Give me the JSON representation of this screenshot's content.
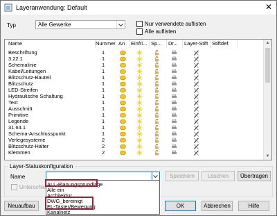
{
  "window": {
    "title": "Layeranwendung: Default",
    "close_glyph": "✕"
  },
  "filter": {
    "type_label": "Typ",
    "type_value": "Alle Gewerke",
    "only_used_label": "Nur verwendete auflisten",
    "all_label": "Alle auflisten"
  },
  "columns": {
    "name": "Name",
    "nummer": "Nummer",
    "an": "An",
    "einfr": "Einfri...",
    "sp": "Sp...",
    "dr": "Dr...",
    "stift": "Layer-Stift",
    "stiftdef": "Stiftdef."
  },
  "rows": [
    {
      "name": "Beschriftung",
      "num": "1",
      "an": "on",
      "fr": "sun",
      "dr": "print"
    },
    {
      "name": "3.22.1",
      "num": "1",
      "an": "on",
      "fr": "sun",
      "dr": "print"
    },
    {
      "name": "Schemalinie",
      "num": "1",
      "an": "on",
      "fr": "sun",
      "dr": "print"
    },
    {
      "name": "Kabel/Leitungen",
      "num": "1",
      "an": "on",
      "fr": "sun",
      "dr": "print"
    },
    {
      "name": "Blitzschutz-Bauteil",
      "num": "1",
      "an": "on",
      "fr": "sun",
      "dr": "print"
    },
    {
      "name": "Blitzschutz",
      "num": "1",
      "an": "on",
      "fr": "sun",
      "dr": "print"
    },
    {
      "name": "LED-Streifen",
      "num": "1",
      "an": "on",
      "fr": "sun",
      "dr": "print"
    },
    {
      "name": "Hydraulische Schaltung",
      "num": "1",
      "an": "on",
      "fr": "sun",
      "dr": "print"
    },
    {
      "name": "Text",
      "num": "1",
      "an": "on",
      "fr": "sun",
      "dr": "print"
    },
    {
      "name": "Ausschnitt",
      "num": "1",
      "an": "on",
      "fr": "sun",
      "dr": "print"
    },
    {
      "name": "Primitive",
      "num": "1",
      "an": "on",
      "fr": "sun",
      "dr": "print"
    },
    {
      "name": "Legende",
      "num": "1",
      "an": "on",
      "fr": "sun",
      "dr": "print"
    },
    {
      "name": "31.64.1",
      "num": "1",
      "an": "on",
      "fr": "sun",
      "dr": "print"
    },
    {
      "name": "Schema-Anschlusspunkt",
      "num": "1",
      "an": "on",
      "fr": "sun",
      "dr": "print"
    },
    {
      "name": "Verlegesysteme",
      "num": "2",
      "an": "on",
      "fr": "sun",
      "dr": "print"
    },
    {
      "name": "Blitzschutz-Halter",
      "num": "2",
      "an": "on",
      "fr": "sun",
      "dr": "print"
    },
    {
      "name": "Klemmen",
      "num": "2",
      "an": "on",
      "fr": "sun",
      "dr": "print"
    }
  ],
  "status": {
    "group_label": "Layer-Statuskonfiguration",
    "name_label": "Name",
    "name_value": "",
    "speichern": "Speichern",
    "loeschen": "Löschen",
    "uebertragen": "Übertragen",
    "unterschied_label": "Unterschied"
  },
  "dropdown": [
    "ALL-Planungsgrundlage",
    "Alle ein",
    "Architektur",
    "DWG_bereinigt",
    "EL-Taster/Bewegung",
    "Kanalnetz"
  ],
  "footer": {
    "neuaufbau": "Neuaufbau",
    "ok": "OK",
    "abbrechen": "Abbrechen",
    "hilfe": "Hilfe"
  },
  "colors": {
    "highlight_border": "#a51b32",
    "focus": "#0078d7"
  }
}
